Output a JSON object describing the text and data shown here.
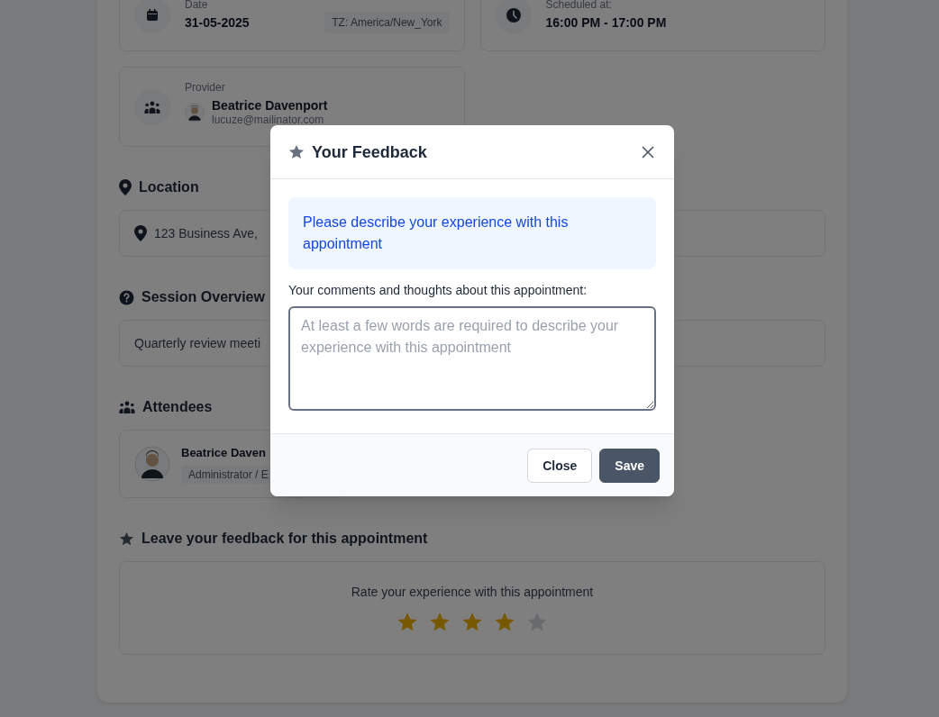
{
  "appointment": {
    "date": {
      "label": "Date",
      "value": "31-05-2025",
      "timezone": "TZ: America/New_York"
    },
    "schedule": {
      "label": "Scheduled at:",
      "value": "16:00 PM - 17:00 PM"
    },
    "provider": {
      "label": "Provider",
      "name": "Beatrice Davenport",
      "email": "lucuze@mailinator.com"
    },
    "location": {
      "heading": "Location",
      "address": "123 Business Ave,"
    },
    "overview": {
      "heading": "Session Overview",
      "text": "Quarterly review meeti"
    },
    "attendees": {
      "heading": "Attendees",
      "items": [
        {
          "name": "Beatrice Daven",
          "role": "Administrator / E"
        }
      ]
    },
    "feedback": {
      "heading": "Leave your feedback for this appointment",
      "prompt": "Rate your experience with this appointment",
      "stars": 4
    }
  },
  "modal": {
    "title": "Your Feedback",
    "notice": "Please describe your experience with this appointment",
    "field_label": "Your comments and thoughts about this appointment:",
    "placeholder": "At least a few words are required to describe your experience with this appointment",
    "buttons": [
      {
        "label": "Close",
        "kind": "secondary"
      },
      {
        "label": "Save",
        "kind": "primary"
      }
    ]
  }
}
